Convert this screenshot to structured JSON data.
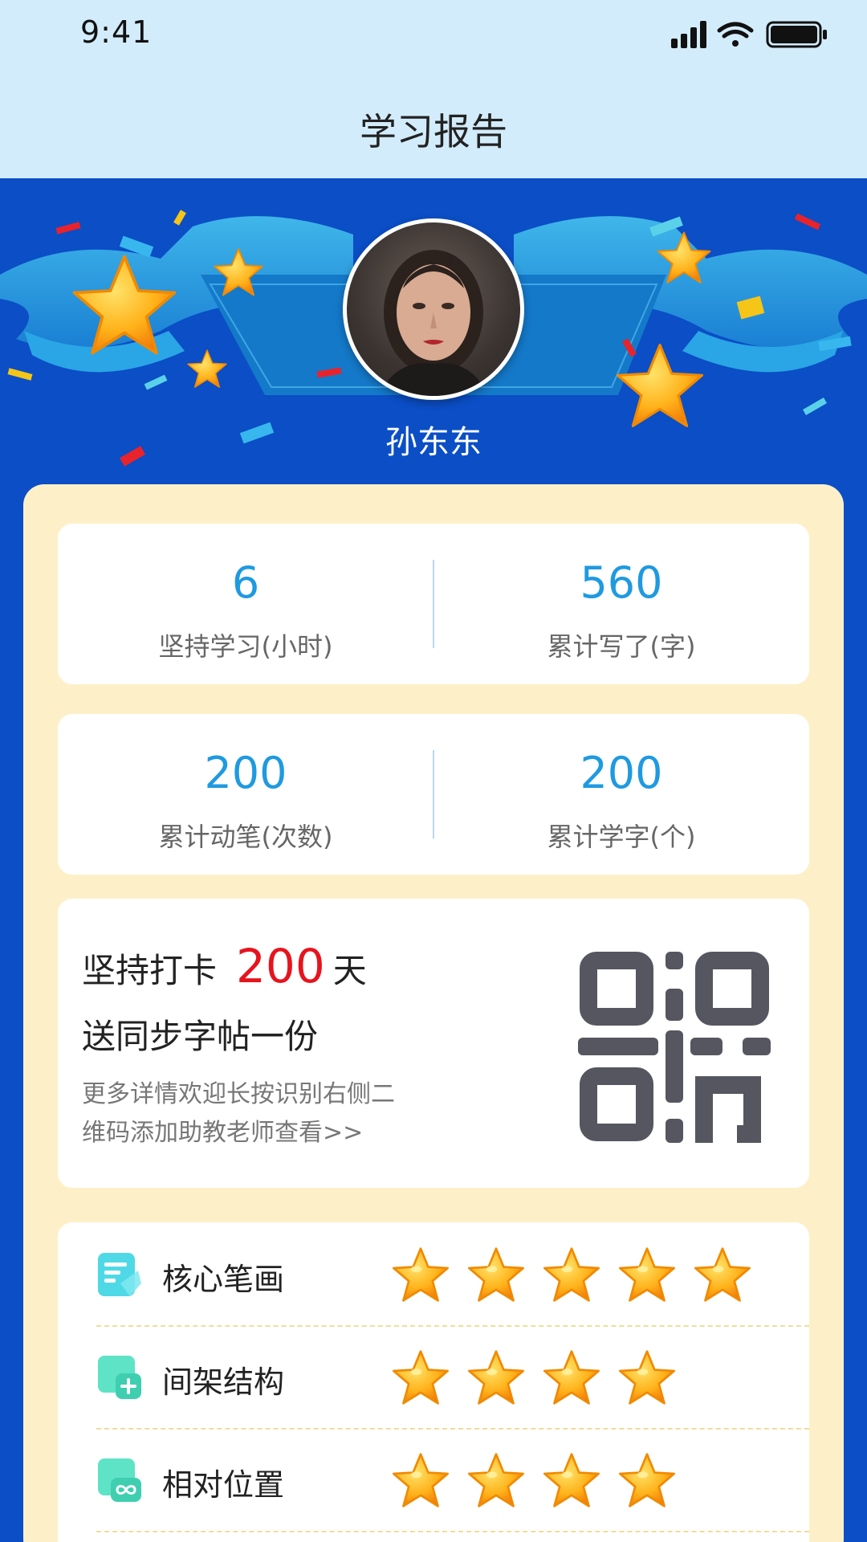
{
  "status_bar": {
    "time": "9:41"
  },
  "header": {
    "title": "学习报告"
  },
  "profile": {
    "name": "孙东东"
  },
  "stats": [
    {
      "value": "6",
      "label": "坚持学习(小时)"
    },
    {
      "value": "560",
      "label": "累计写了(字)"
    },
    {
      "value": "200",
      "label": "累计动笔(次数)"
    },
    {
      "value": "200",
      "label": "累计学字(个)"
    }
  ],
  "checkin": {
    "prefix": "坚持打卡",
    "days": "200",
    "suffix": "天",
    "reward": "送同步字帖一份",
    "desc_line1": "更多详情欢迎长按识别右侧二",
    "desc_line2": "维码添加助教老师查看>>"
  },
  "ratings": [
    {
      "label": "核心笔画",
      "stars": 5,
      "icon": "document-icon"
    },
    {
      "label": "间架结构",
      "stars": 4,
      "icon": "add-frame-icon"
    },
    {
      "label": "相对位置",
      "stars": 4,
      "icon": "infinity-icon"
    }
  ],
  "colors": {
    "header_bg": "#d3ecfb",
    "page_bg": "#0b4ec6",
    "panel_bg": "#fdf0c9",
    "stat_value": "#1f9ae0",
    "highlight_red": "#e6141e",
    "icon_teal": "#3fd8c4"
  }
}
